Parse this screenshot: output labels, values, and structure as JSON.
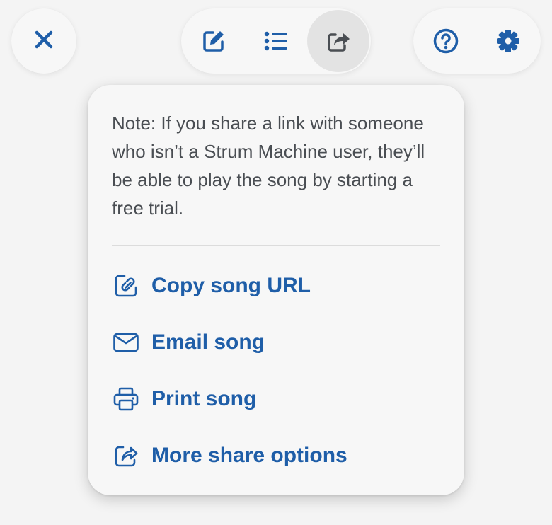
{
  "colors": {
    "accent": "#1f5ea8",
    "note_text": "#4a4e53",
    "background": "#f4f4f4",
    "panel": "#f7f7f7",
    "active_button": "#e3e3e3"
  },
  "toolbar": {
    "close_icon": "close-icon",
    "tools": [
      {
        "icon": "edit-icon",
        "active": false
      },
      {
        "icon": "list-icon",
        "active": false
      },
      {
        "icon": "share-icon",
        "active": true
      }
    ],
    "help_icon": "help-icon",
    "settings_icon": "gear-icon"
  },
  "share_menu": {
    "note": "Note: If you share a link with someone who isn’t a Strum Machine user, they’ll be able to play the song by starting a free trial.",
    "items": [
      {
        "label": "Copy song URL",
        "icon": "link-icon"
      },
      {
        "label": "Email song",
        "icon": "envelope-icon"
      },
      {
        "label": "Print song",
        "icon": "printer-icon"
      },
      {
        "label": "More share options",
        "icon": "share-icon"
      }
    ]
  }
}
